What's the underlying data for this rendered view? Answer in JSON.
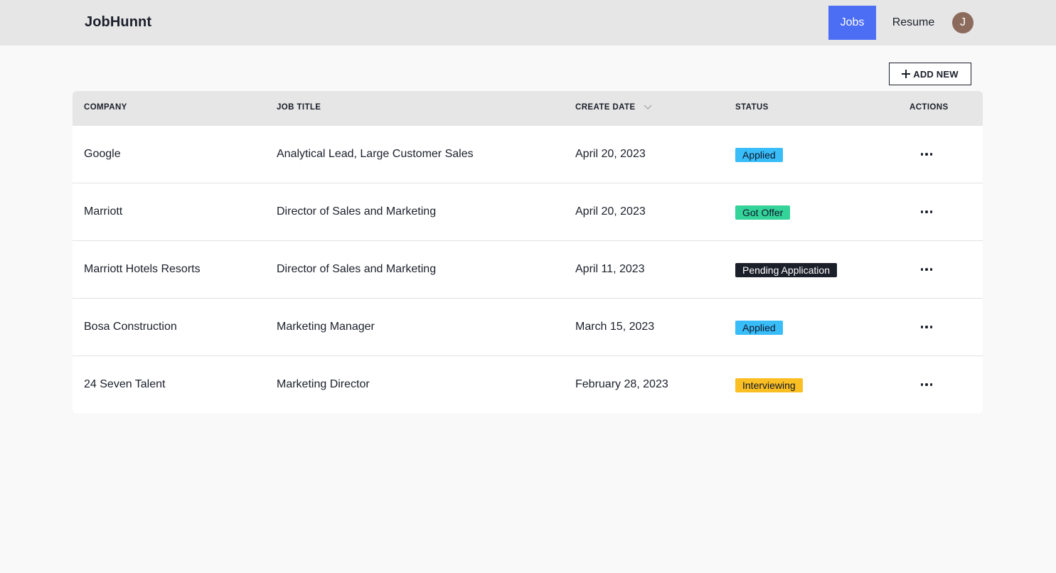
{
  "app": {
    "brand": "JobHunnt",
    "nav": {
      "jobs": "Jobs",
      "resume": "Resume"
    },
    "avatar_initial": "J"
  },
  "toolbar": {
    "add_new_label": "ADD NEW"
  },
  "table": {
    "headers": {
      "company": "COMPANY",
      "job_title": "JOB TITLE",
      "create_date": "CREATE DATE",
      "status": "STATUS",
      "actions": "ACTIONS"
    },
    "sort": {
      "column": "create_date",
      "direction": "descending",
      "icon": "chevron-down-icon"
    },
    "rows": [
      {
        "company": "Google",
        "job_title": "Analytical Lead, Large Customer Sales",
        "create_date": "April 20, 2023",
        "status": "Applied",
        "status_color": "#38bdf8",
        "status_text_color": "#0f172a"
      },
      {
        "company": "Marriott",
        "job_title": "Director of Sales and Marketing",
        "create_date": "April 20, 2023",
        "status": "Got Offer",
        "status_color": "#34d399",
        "status_text_color": "#0f172a"
      },
      {
        "company": "Marriott Hotels Resorts",
        "job_title": "Director of Sales and Marketing",
        "create_date": "April 11, 2023",
        "status": "Pending Application",
        "status_color": "#1b1f2a",
        "status_text_color": "#ffffff"
      },
      {
        "company": "Bosa Construction",
        "job_title": "Marketing Manager",
        "create_date": "March 15, 2023",
        "status": "Applied",
        "status_color": "#38bdf8",
        "status_text_color": "#0f172a"
      },
      {
        "company": "24 Seven Talent",
        "job_title": "Marketing Director",
        "create_date": "February 28, 2023",
        "status": "Interviewing",
        "status_color": "#fbbf24",
        "status_text_color": "#0f172a"
      }
    ]
  },
  "colors": {
    "accent": "#4c6ef5",
    "header_bg": "#e6e6e6",
    "avatar_bg": "#8c6b5d"
  }
}
